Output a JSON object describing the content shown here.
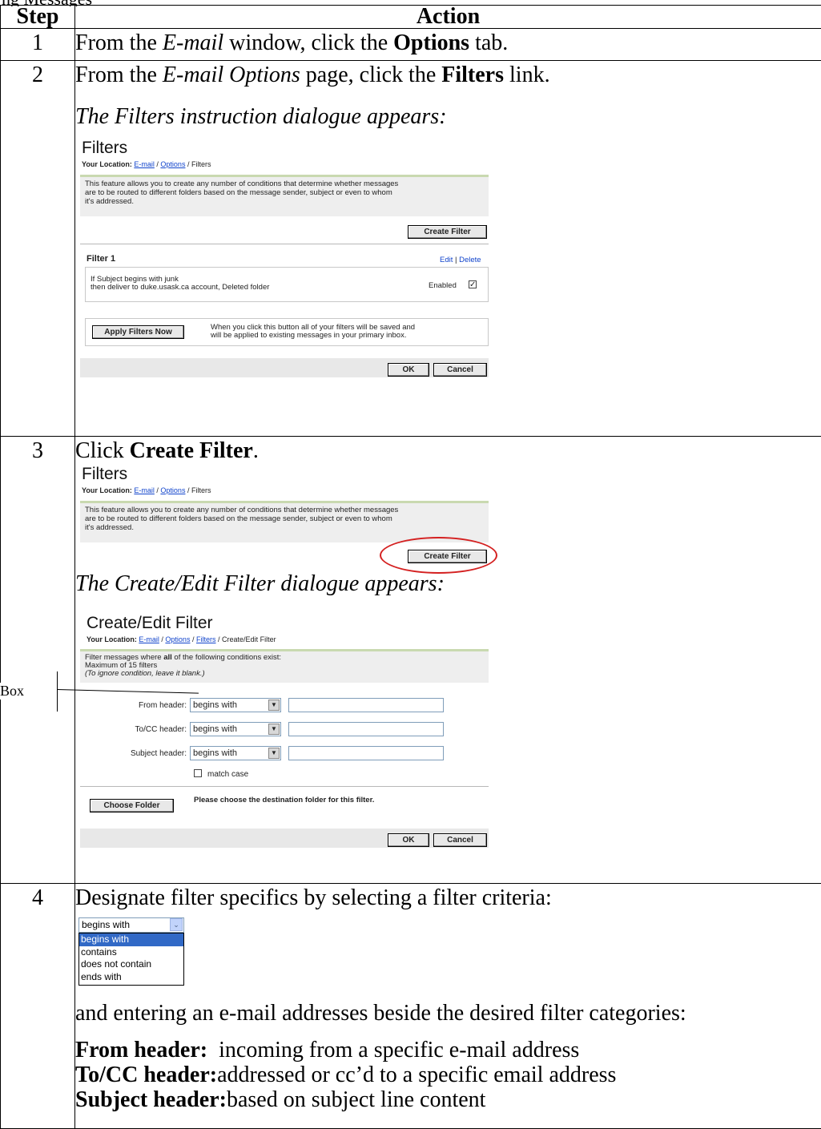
{
  "header_fragment": "ng Messages",
  "columns": {
    "step": "Step",
    "action": "Action"
  },
  "rows": [
    {
      "num": "1",
      "parts": [
        "From the ",
        "E-mail",
        " window, click the ",
        "Options",
        " tab."
      ]
    },
    {
      "num": "2",
      "parts": [
        "From the ",
        "E-mail Options",
        " page, click the ",
        "Filters",
        " link."
      ],
      "caption": "The Filters instruction dialogue appears:"
    },
    {
      "num": "3",
      "parts": [
        "Click ",
        "Create Filter",
        "."
      ],
      "caption": "The Create/Edit Filter dialogue appears:"
    },
    {
      "num": "4",
      "text": "Designate filter specifics by selecting a filter criteria:",
      "text2": "and entering an e-mail addresses beside the desired filter categories:",
      "defs": [
        {
          "term": "From header:",
          "desc": "incoming from a specific e-mail address"
        },
        {
          "term": "To/CC header:",
          "desc": "addressed or cc’d to a specific email address"
        },
        {
          "term": "Subject header:",
          "desc": "based on subject line content"
        }
      ]
    }
  ],
  "filters_panel": {
    "title": "Filters",
    "loc_label": "Your Location:",
    "crumb1": "E-mail",
    "crumb2": "Options",
    "crumb3": "Filters",
    "sep": "/",
    "note_l1": "This feature allows you to create any number of conditions that determine whether messages",
    "note_l2": "are to be routed to different folders based on the message sender, subject or even to whom",
    "note_l3": "it's addressed.",
    "create_button": "Create Filter",
    "filter_name": "Filter 1",
    "edit_link": "Edit",
    "divider": "|",
    "delete_link": "Delete",
    "rule_l1": "If Subject  begins with  junk",
    "rule_l2": "then deliver to duke.usask.ca account, Deleted folder",
    "enabled_label": "Enabled",
    "apply_button": "Apply Filters Now",
    "apply_l1": "When you click this button all of your filters will be saved and",
    "apply_l2": "will be applied to existing messages in your primary inbox.",
    "ok": "OK",
    "cancel": "Cancel"
  },
  "edit_panel": {
    "title": "Create/Edit Filter",
    "crumb4": "Create/Edit Filter",
    "note_l1a": "Filter messages where ",
    "note_l1b": "all",
    "note_l1c": " of the following conditions exist:",
    "note_l2": "Maximum of 15 filters",
    "note_l3": "(To ignore condition, leave it blank.)",
    "callout": "Box",
    "from_label": "From header:",
    "tocc_label": "To/CC header:",
    "subject_label": "Subject header:",
    "select_value": "begins with",
    "match_case": "match case",
    "choose_button": "Choose Folder",
    "choose_note": "Please choose the destination folder for this filter."
  },
  "dropdown": {
    "current": "begins with",
    "options": [
      "begins with",
      "contains",
      "does not contain",
      "ends with"
    ]
  },
  "colors": {
    "highlight": "#3169c6",
    "accent_line": "#c9d9b0",
    "ellipse": "#d42020",
    "link": "#1144cc"
  }
}
